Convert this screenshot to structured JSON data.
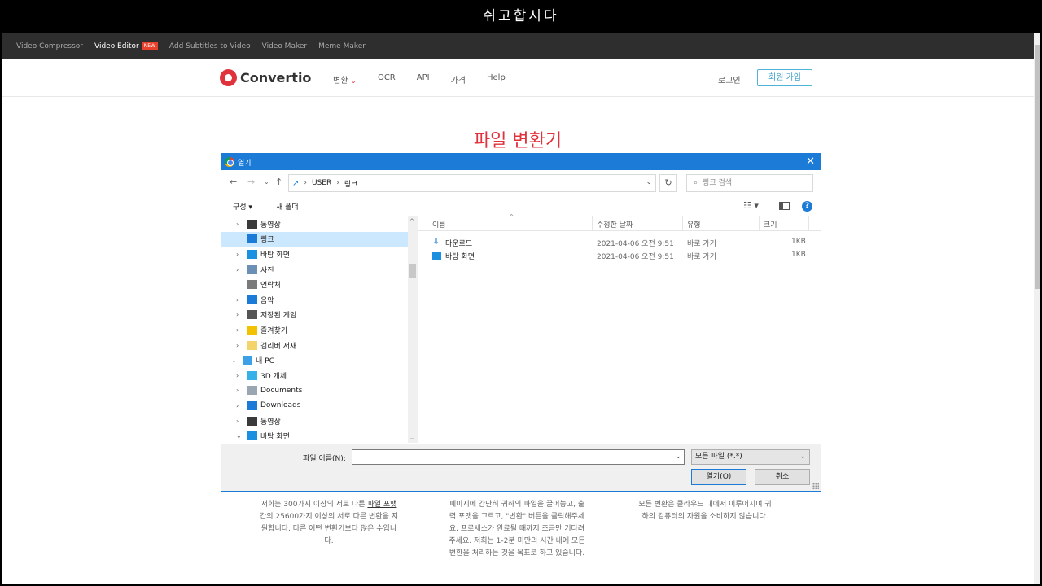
{
  "overlay_title": "쉬고합시다",
  "promo_bar": {
    "items": [
      "Video Compressor",
      "Video Editor",
      "Add Subtitles to Video",
      "Video Maker",
      "Meme Maker"
    ],
    "new_badge": "NEW"
  },
  "nav": {
    "logo": "Convertio",
    "menu": [
      "변환",
      "OCR",
      "API",
      "가격",
      "Help"
    ],
    "login": "로그인",
    "signup": "회원 가입"
  },
  "hero_title": "파일 변환기",
  "features": [
    {
      "pre": "저희는 300가지 이상의 서로 다른 ",
      "link": "파일 포맷",
      "post": " 간의 25600가지 이상의 서로 다른 변환을 지원합니다. 다른 어떤 변환기보다 많은 수입니다."
    },
    {
      "pre": "페이지에 간단히 귀하의 파일을 끌어놓고, 출력 포맷을 고르고, \"변환\" 버튼을 클릭해주세요. 프로세스가 완료될 때까지 조금만 기다려주세요. 저희는 1-2분 미만의 시간 내에 모든 변환을 처리하는 것을 목표로 하고 있습니다.",
      "link": "",
      "post": ""
    },
    {
      "pre": "모든 변환은 클라우드 내에서 이루어지며 귀하의 컴퓨터의 자원을 소비하지 않습니다.",
      "link": "",
      "post": ""
    }
  ],
  "dialog": {
    "title": "열기",
    "close": "✕",
    "address": [
      "USER",
      "링크"
    ],
    "search_placeholder": "링크 검색",
    "organize": "구성 ▾",
    "new_folder": "새 폴더",
    "help": "?",
    "tree": [
      {
        "label": "동영상",
        "level": 1,
        "arrow": "›",
        "icon": "video-icon",
        "color": "#3a3a3a"
      },
      {
        "label": "링크",
        "level": 1,
        "arrow": "",
        "icon": "link-icon",
        "color": "#1c7bd6",
        "selected": true
      },
      {
        "label": "바탕 화면",
        "level": 1,
        "arrow": "›",
        "icon": "desktop-icon",
        "color": "#1c90e0"
      },
      {
        "label": "사진",
        "level": 1,
        "arrow": "›",
        "icon": "pictures-icon",
        "color": "#6b8fb5"
      },
      {
        "label": "연락처",
        "level": 1,
        "arrow": "",
        "icon": "contacts-icon",
        "color": "#7a7a7a"
      },
      {
        "label": "음악",
        "level": 1,
        "arrow": "›",
        "icon": "music-icon",
        "color": "#1c7bd6"
      },
      {
        "label": "저장된 게임",
        "level": 1,
        "arrow": "›",
        "icon": "games-icon",
        "color": "#555555"
      },
      {
        "label": "즐겨찾기",
        "level": 1,
        "arrow": "›",
        "icon": "star-icon",
        "color": "#f2c100"
      },
      {
        "label": "검리버 서재",
        "level": 1,
        "arrow": "›",
        "icon": "folder-icon",
        "color": "#f5d36b"
      },
      {
        "label": "내 PC",
        "level": 0,
        "arrow": "⌄",
        "icon": "pc-icon",
        "color": "#3ba0e6"
      },
      {
        "label": "3D 개체",
        "level": 1,
        "arrow": "›",
        "icon": "3d-icon",
        "color": "#35b0e8"
      },
      {
        "label": "Documents",
        "level": 1,
        "arrow": "›",
        "icon": "documents-icon",
        "color": "#9aa6b2"
      },
      {
        "label": "Downloads",
        "level": 1,
        "arrow": "›",
        "icon": "downloads-icon",
        "color": "#1c7bd6"
      },
      {
        "label": "동영상",
        "level": 1,
        "arrow": "›",
        "icon": "video-icon",
        "color": "#3a3a3a"
      },
      {
        "label": "바탕 화면",
        "level": 1,
        "arrow": "⌄",
        "icon": "desktop-icon",
        "color": "#1c90e0"
      }
    ],
    "columns": [
      "이름",
      "수정한 날짜",
      "유형",
      "크기"
    ],
    "files": [
      {
        "name": "다운로드",
        "date": "2021-04-06 오전 9:51",
        "type": "바로 가기",
        "size": "1KB",
        "icon": "downloads-shortcut-icon"
      },
      {
        "name": "바탕 화면",
        "date": "2021-04-06 오전 9:51",
        "type": "바로 가기",
        "size": "1KB",
        "icon": "desktop-shortcut-icon"
      }
    ],
    "filename_label": "파일 이름(N):",
    "filename_value": "",
    "filter": "모든 파일 (*.*)",
    "open_button": "열기(O)",
    "cancel_button": "취소"
  },
  "colors": {
    "brand": "#e0323c",
    "dialog_accent": "#1c7bd6",
    "selection": "#cce8ff"
  }
}
